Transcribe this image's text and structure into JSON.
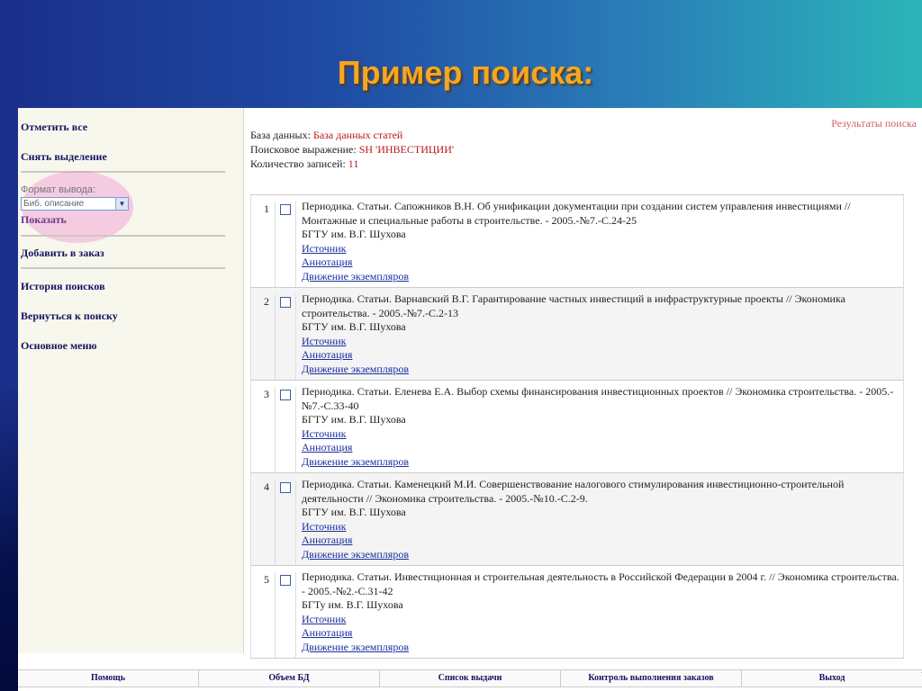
{
  "slide_title": "Пример поиска:",
  "sidebar": {
    "select_all": "Отметить все",
    "deselect": "Снять выделение",
    "format_label": "Формат вывода:",
    "format_value": "Биб. описание",
    "show": "Показать",
    "add_to_order": "Добавить в заказ",
    "search_history": "История поисков",
    "back_to_search": "Вернуться к поиску",
    "main_menu": "Основное меню"
  },
  "main": {
    "results_label": "Результаты поиска",
    "db_label": "База данных:",
    "db_value": "База данных статей",
    "query_label": "Поисковое выражение:",
    "query_value": "SH 'ИНВЕСТИЦИИ'",
    "count_label": "Количество записей:",
    "count_value": "11"
  },
  "records": [
    {
      "num": "1",
      "description": "Периодика. Статьи. Сапожников В.Н. Об унификации документации при создании систем управления инвестициями // Монтажные и специальные работы в строительстве. - 2005.-№7.-С.24-25",
      "library": "БГТУ им. В.Г. Шухова",
      "link_source": "Источник",
      "link_annotation": "Аннотация",
      "link_copies": "Движение экземпляров"
    },
    {
      "num": "2",
      "description": "Периодика. Статьи. Варнавский В.Г. Гарантирование частных инвестиций в инфраструктурные проекты // Экономика строительства. - 2005.-№7.-С.2-13",
      "library": "БГТУ им. В.Г. Шухова",
      "link_source": "Источник",
      "link_annotation": "Аннотация",
      "link_copies": "Движение экземпляров"
    },
    {
      "num": "3",
      "description": "Периодика. Статьи. Еленева Е.А. Выбор схемы финансирования инвестиционных проектов // Экономика строительства. - 2005.-№7.-С.33-40",
      "library": "БГТУ им. В.Г. Шухова",
      "link_source": "Источник",
      "link_annotation": "Аннотация",
      "link_copies": "Движение экземпляров"
    },
    {
      "num": "4",
      "description": "Периодика. Статьи. Каменецкий М.И. Совершенствование налогового стимулирования инвестиционно-строительной деятельности // Экономика строительства. - 2005.-№10.-С.2-9.",
      "library": "БГТУ им. В.Г. Шухова",
      "link_source": "Источник",
      "link_annotation": "Аннотация",
      "link_copies": "Движение экземпляров"
    },
    {
      "num": "5",
      "description": "Периодика. Статьи. Инвестиционная и строительная деятельность в Российской Федерации в 2004 г. // Экономика строительства. - 2005.-№2.-С.31-42",
      "library": "БГТу им. В.Г. Шухова",
      "link_source": "Источник",
      "link_annotation": "Аннотация",
      "link_copies": "Движение экземпляров"
    }
  ],
  "bottom_nav": {
    "help": "Помощь",
    "db_size": "Объем БД",
    "loan_list": "Список выдачи",
    "order_control": "Контроль выполнения заказов",
    "exit": "Выход"
  },
  "colors": {
    "title": "#f5a623",
    "link": "#1a2ea0",
    "value_red": "#c01818",
    "sidebar_bg": "#f7f7ee"
  }
}
